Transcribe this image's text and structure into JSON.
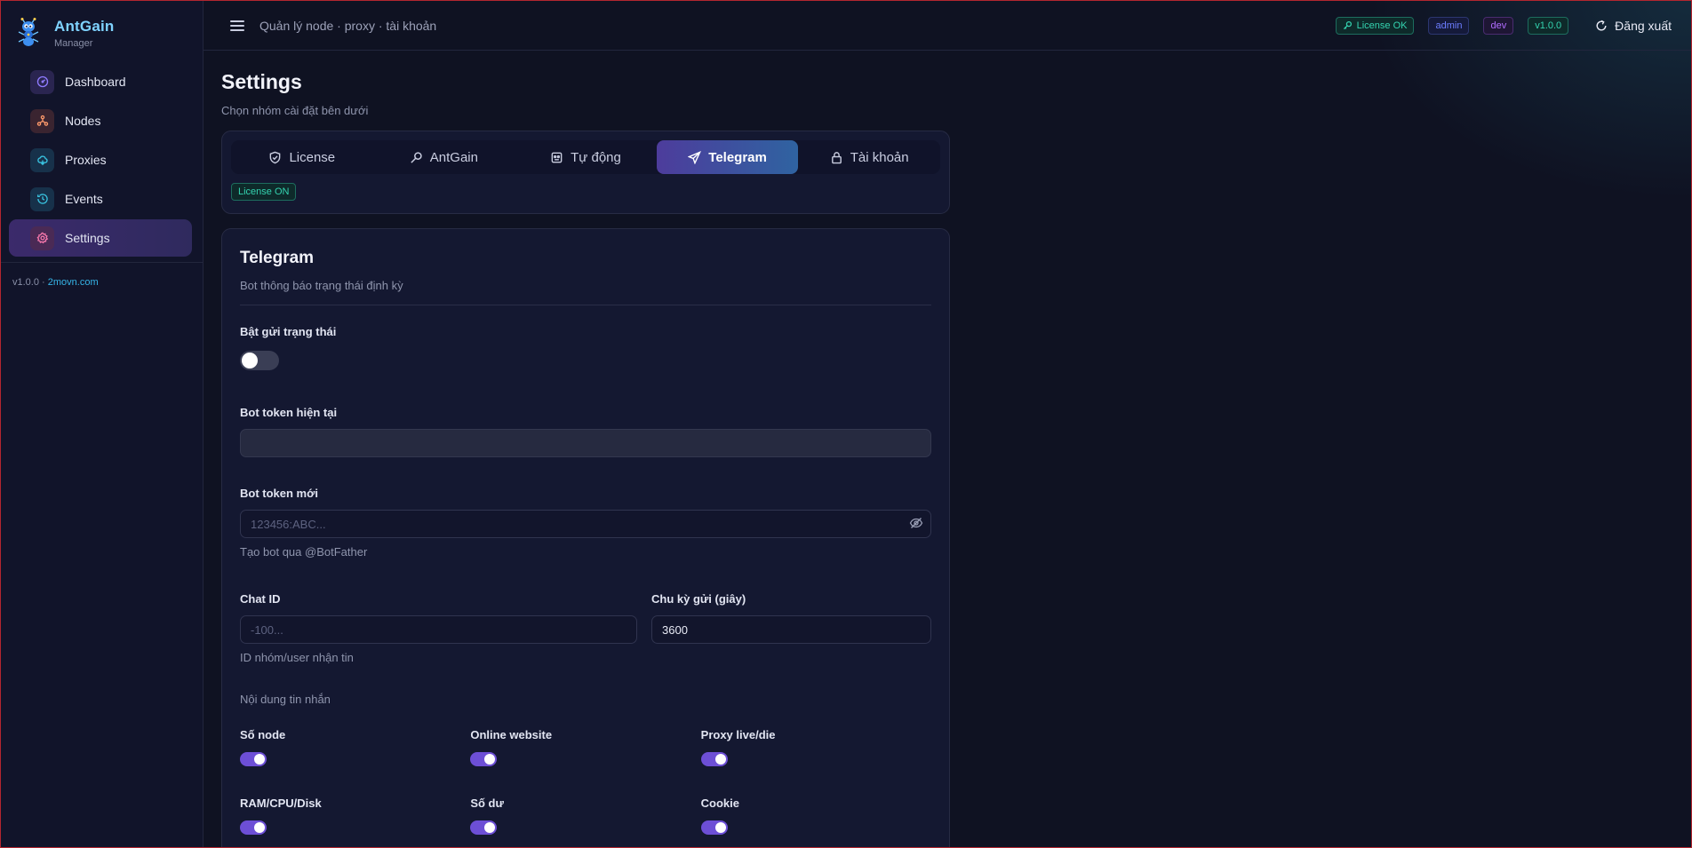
{
  "brand": {
    "name": "AntGain",
    "sub": "Manager"
  },
  "sidebar": {
    "items": [
      {
        "label": "Dashboard",
        "icon": "gauge-icon",
        "color": "#8f7bff",
        "bg": "#2a2550"
      },
      {
        "label": "Nodes",
        "icon": "network-icon",
        "color": "#ff9a6b",
        "bg": "#3a2430"
      },
      {
        "label": "Proxies",
        "icon": "cloud-icon",
        "color": "#39c3e0",
        "bg": "#17314a"
      },
      {
        "label": "Events",
        "icon": "clock-icon",
        "color": "#39c3e0",
        "bg": "#17314a"
      },
      {
        "label": "Settings",
        "icon": "gear-icon",
        "color": "#ff7bb0",
        "bg": "#4a2a55"
      }
    ],
    "active": "Settings",
    "footer_version": "v1.0.0 ·",
    "footer_link": "2movn.com"
  },
  "topbar": {
    "title": "Quản lý node · proxy · tài khoản",
    "badges": {
      "license": "License OK",
      "admin": "admin",
      "dev": "dev",
      "version": "v1.0.0"
    },
    "logout": "Đăng xuất"
  },
  "page": {
    "title": "Settings",
    "subtitle": "Chọn nhóm cài đặt bên dưới"
  },
  "tabs": {
    "items": [
      "License",
      "AntGain",
      "Tự động",
      "Telegram",
      "Tài khoản"
    ],
    "active": "Telegram",
    "license_badge": "License ON"
  },
  "telegram": {
    "title": "Telegram",
    "subtitle": "Bot thông báo trạng thái định kỳ",
    "enable_label": "Bật gửi trạng thái",
    "enable_on": false,
    "current_token_label": "Bot token hiện tại",
    "current_token_value": "",
    "new_token_label": "Bot token mới",
    "new_token_placeholder": "123456:ABC...",
    "new_token_hint": "Tạo bot qua @BotFather",
    "chat_id_label": "Chat ID",
    "chat_id_placeholder": "-100...",
    "chat_id_hint": "ID nhóm/user nhận tin",
    "interval_label": "Chu kỳ gửi (giây)",
    "interval_value": "3600",
    "content_label": "Nội dung tin nhắn",
    "options": [
      {
        "label": "Số node",
        "on": true
      },
      {
        "label": "Online website",
        "on": true
      },
      {
        "label": "Proxy live/die",
        "on": true
      },
      {
        "label": "RAM/CPU/Disk",
        "on": true
      },
      {
        "label": "Số dư",
        "on": true
      },
      {
        "label": "Cookie",
        "on": true
      }
    ]
  }
}
